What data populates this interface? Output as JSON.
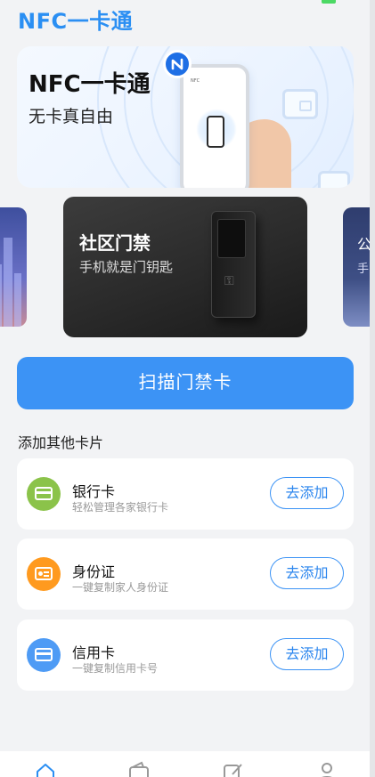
{
  "header": {
    "title": "NFC一卡通"
  },
  "hero": {
    "title": "NFC一卡通",
    "subtitle": "无卡真自由",
    "badge_icon": "nfc-icon",
    "phone_label": "NFC"
  },
  "carousel": {
    "main": {
      "title": "社区门禁",
      "subtitle": "手机就是门钥匙"
    },
    "right_peek": {
      "title": "公",
      "subtitle": "手"
    }
  },
  "scan_button": {
    "label": "扫描门禁卡"
  },
  "section": {
    "title": "添加其他卡片"
  },
  "cards": [
    {
      "name": "银行卡",
      "desc": "轻松管理各家银行卡",
      "button": "去添加",
      "icon": "bank-card-icon",
      "color": "#8bc34a"
    },
    {
      "name": "身份证",
      "desc": "一键复制家人身份证",
      "button": "去添加",
      "icon": "id-card-icon",
      "color": "#ff9a1f"
    },
    {
      "name": "信用卡",
      "desc": "一键复制信用卡号",
      "button": "去添加",
      "icon": "credit-card-icon",
      "color": "#4e9bf5"
    }
  ],
  "tabbar": {
    "tabs": [
      {
        "icon": "home-icon",
        "active": true
      },
      {
        "icon": "wallet-icon",
        "active": false
      },
      {
        "icon": "edit-icon",
        "active": false
      },
      {
        "icon": "user-icon",
        "active": false
      }
    ]
  },
  "colors": {
    "accent": "#3c93f5",
    "title_blue": "#2b8ff3"
  }
}
